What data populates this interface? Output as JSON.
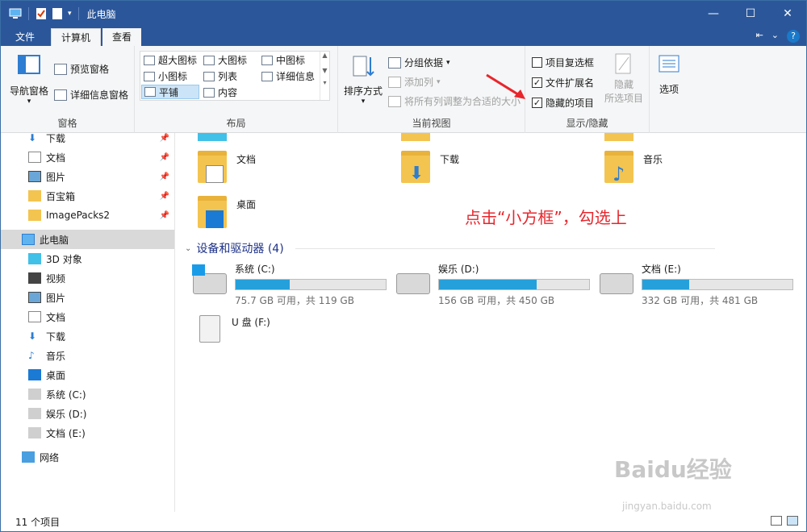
{
  "window": {
    "title": "此电脑"
  },
  "tabs": [
    {
      "label": "文件"
    },
    {
      "label": "计算机"
    },
    {
      "label": "查看"
    }
  ],
  "ribbon": {
    "pane_group": {
      "nav_pane": "导航窗格",
      "preview_pane": "预览窗格",
      "details_pane": "详细信息窗格",
      "label": "窗格"
    },
    "layout_group": {
      "items": [
        "超大图标",
        "大图标",
        "中图标",
        "小图标",
        "列表",
        "详细信息",
        "平铺",
        "内容"
      ],
      "selected": "平铺",
      "label": "布局"
    },
    "current_view_group": {
      "sort_by": "排序方式",
      "group_by": "分组依据",
      "add_columns": "添加列",
      "size_all_columns": "将所有列调整为合适的大小",
      "label": "当前视图"
    },
    "show_hide_group": {
      "item_checkboxes": {
        "label": "项目复选框",
        "checked": false
      },
      "file_extensions": {
        "label": "文件扩展名",
        "checked": true
      },
      "hidden_items": {
        "label": "隐藏的项目",
        "checked": true
      },
      "hide_selected_line1": "隐藏",
      "hide_selected_line2": "所选项目",
      "label": "显示/隐藏"
    },
    "options": "选项"
  },
  "nav": {
    "quick_access": [
      {
        "label": "下载",
        "icon": "download-icon"
      },
      {
        "label": "文档",
        "icon": "document-icon"
      },
      {
        "label": "图片",
        "icon": "picture-icon"
      },
      {
        "label": "百宝箱",
        "icon": "folder-icon"
      },
      {
        "label": "ImagePacks2",
        "icon": "folder-icon"
      }
    ],
    "this_pc": "此电脑",
    "this_pc_items": [
      {
        "label": "3D 对象"
      },
      {
        "label": "视频"
      },
      {
        "label": "图片"
      },
      {
        "label": "文档"
      },
      {
        "label": "下载"
      },
      {
        "label": "音乐"
      },
      {
        "label": "桌面"
      },
      {
        "label": "系统 (C:)"
      },
      {
        "label": "娱乐 (D:)"
      },
      {
        "label": "文档 (E:)"
      }
    ],
    "network": "网络"
  },
  "content": {
    "folders": [
      {
        "name": "文档"
      },
      {
        "name": "下载"
      },
      {
        "name": "音乐"
      },
      {
        "name": "桌面"
      }
    ],
    "devices_header": "设备和驱动器 (4)",
    "drives": [
      {
        "name": "系统 (C:)",
        "free_text": "75.7 GB 可用，共 119 GB",
        "used_fraction": 0.36
      },
      {
        "name": "娱乐 (D:)",
        "free_text": "156 GB 可用，共 450 GB",
        "used_fraction": 0.65
      },
      {
        "name": "文档 (E:)",
        "free_text": "332 GB 可用，共 481 GB",
        "used_fraction": 0.31
      }
    ],
    "usb": {
      "name": "U 盘 (F:)"
    },
    "annotation": "点击“小方框”，勾选上"
  },
  "status": {
    "count": "11 个项目"
  },
  "watermark": {
    "main": "Baidu经验",
    "sub": "jingyan.baidu.com"
  },
  "colors": {
    "titlebar": "#2b579a",
    "bar_fill": "#26a0da",
    "annotation": "#e8262c"
  }
}
